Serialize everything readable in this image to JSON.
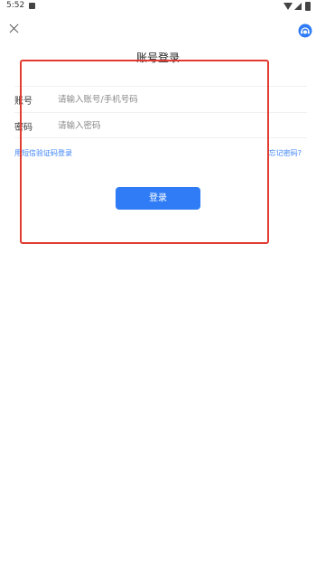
{
  "status_bar": {
    "time": "5:52",
    "icons": [
      "notification-icon",
      "wifi-icon",
      "signal-icon",
      "battery-icon"
    ]
  },
  "header": {
    "close_icon": "close-icon",
    "service_icon": "customer-service-icon",
    "title": "账号登录"
  },
  "form": {
    "account": {
      "label": "账号",
      "placeholder": "请输入账号/手机号码",
      "value": ""
    },
    "password": {
      "label": "密码",
      "placeholder": "请输入密码",
      "value": ""
    },
    "sms_login_link": "用短信验证码登录",
    "forgot_password_link": "忘记密码?",
    "login_button": "登录"
  },
  "colors": {
    "accent": "#2f7cf6",
    "link": "#3a82f7",
    "highlight": "#e03c31"
  }
}
